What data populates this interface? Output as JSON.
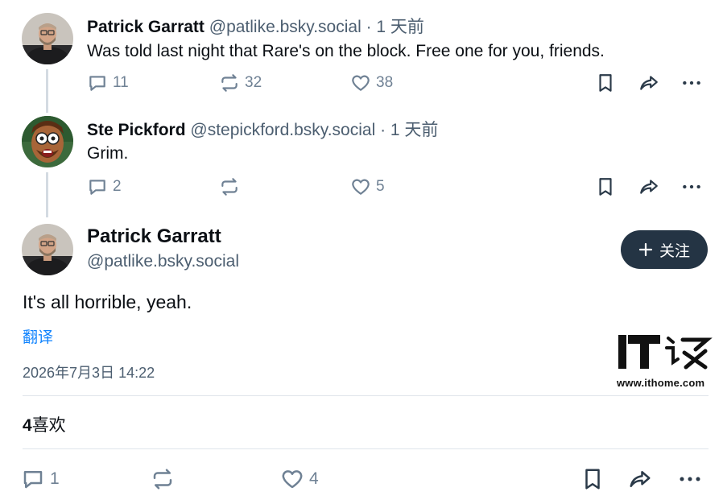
{
  "posts": [
    {
      "name": "Patrick Garratt",
      "handle": "@patlike.bsky.social",
      "time": "· 1 天前",
      "text": "Was told last night that Rare's on the block. Free one for you, friends.",
      "replies": "11",
      "reposts": "32",
      "likes": "38"
    },
    {
      "name": "Ste Pickford",
      "handle": "@stepickford.bsky.social",
      "time": "· 1 天前",
      "text": "Grim.",
      "replies": "2",
      "reposts": "",
      "likes": "5"
    }
  ],
  "main_post": {
    "name": "Patrick Garratt",
    "handle": "@patlike.bsky.social",
    "follow_label": "关注",
    "text": "It's all horrible, yeah.",
    "translate": "翻译",
    "timestamp": "2026年7月3日 14:22",
    "like_count": "4",
    "like_label": "喜欢",
    "replies": "1",
    "reposts": "",
    "likes": "4"
  },
  "watermark": {
    "logo_text": "IT之家",
    "url": "www.ithome.com"
  },
  "colors": {
    "action_gray": "#6f8194",
    "handle_gray": "#4c5e70",
    "link_blue": "#1083fe",
    "follow_bg": "#243444",
    "thread_line": "#d4dbe2"
  },
  "icons": [
    "reply-icon",
    "repost-icon",
    "like-icon",
    "bookmark-icon",
    "share-icon",
    "more-icon",
    "plus-icon"
  ]
}
